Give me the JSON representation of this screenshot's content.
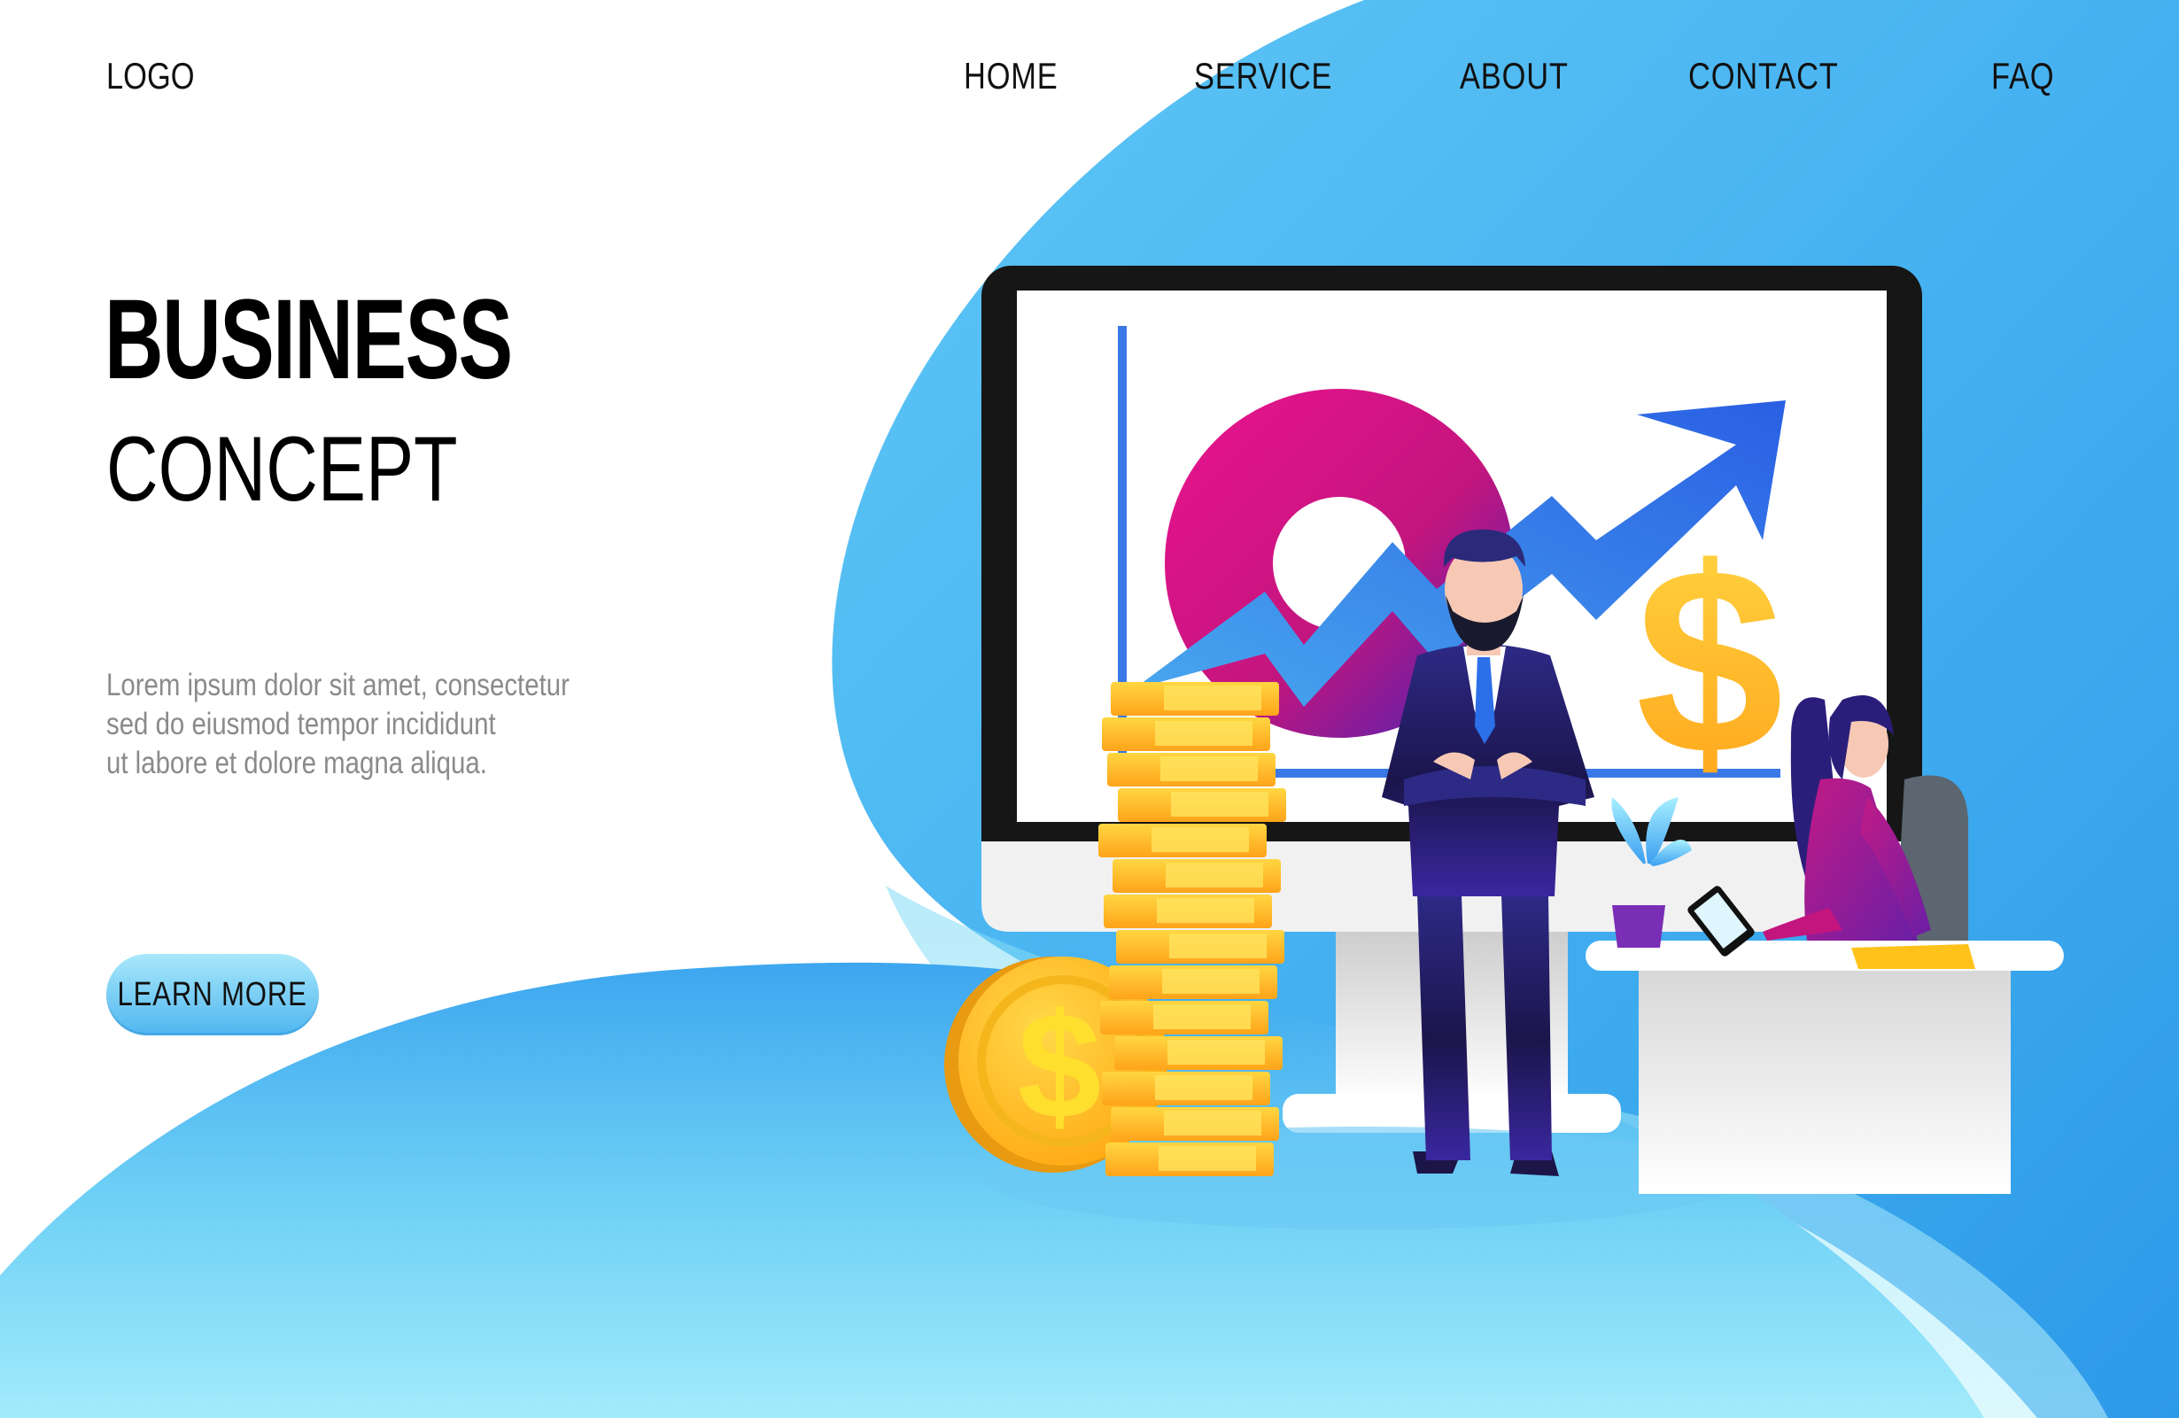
{
  "header": {
    "logo": "LOGO",
    "nav": [
      "HOME",
      "SERVICE",
      "ABOUT",
      "CONTACT",
      "FAQ"
    ]
  },
  "hero": {
    "title": "BUSINESS",
    "subtitle": "CONCEPT",
    "body_lines": [
      "Lorem ipsum dolor sit amet, consectetur",
      "sed do eiusmod tempor incididunt",
      "ut labore et dolore magna aliqua."
    ],
    "cta_label": "LEARN MORE"
  },
  "illustration": {
    "currency_symbol": "$"
  },
  "colors": {
    "sky_blue": "#4cb8f2",
    "pale_blue": "#9ae8fa",
    "accent_blue": "#2f6ee6",
    "magenta": "#e0148a",
    "purple": "#7a1fa0",
    "gold": "#ffc21a",
    "suit_navy": "#241b6e"
  },
  "icons": [
    "growth-arrow-icon",
    "dollar-sign-icon",
    "donut-chart-icon",
    "coin-icon",
    "tablet-icon",
    "plant-icon"
  ]
}
